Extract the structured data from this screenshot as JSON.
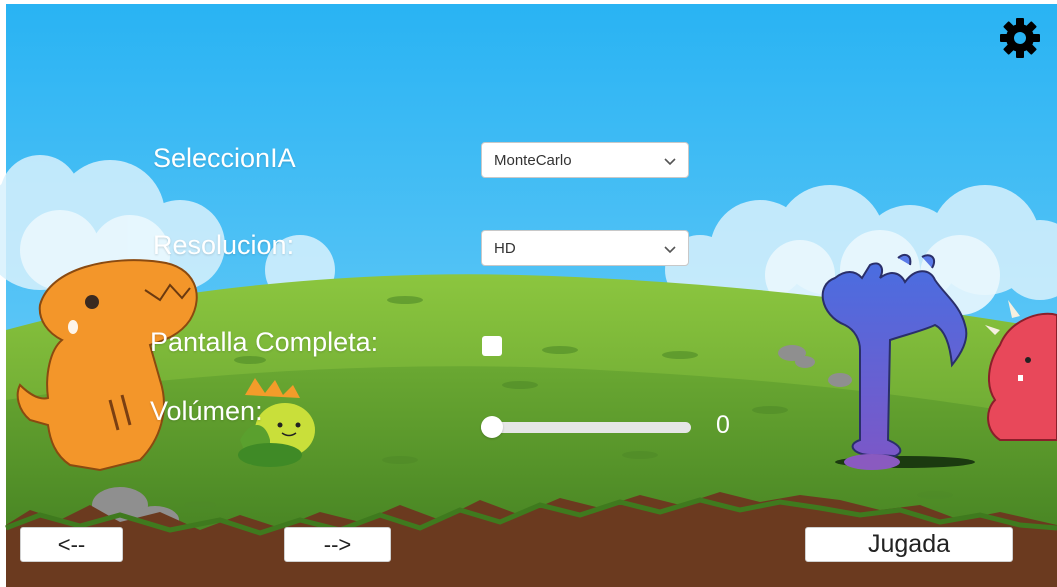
{
  "settings": {
    "icon": "gear-icon"
  },
  "form": {
    "ia": {
      "label": "SeleccionIA",
      "value": "MonteCarlo"
    },
    "resolution": {
      "label": "Resolucion:",
      "value": "HD"
    },
    "fullscreen": {
      "label": "Pantalla Completa:",
      "checked": false
    },
    "volume": {
      "label": "Volúmen:",
      "value": 0,
      "level": 0
    }
  },
  "nav": {
    "prev_label": "<--",
    "next_label": "-->",
    "play_label": "Jugada"
  },
  "colors": {
    "sky": "#2bb5f2",
    "grass": "#5a9a2e",
    "soil": "#6b3a1f",
    "white": "#ffffff"
  }
}
